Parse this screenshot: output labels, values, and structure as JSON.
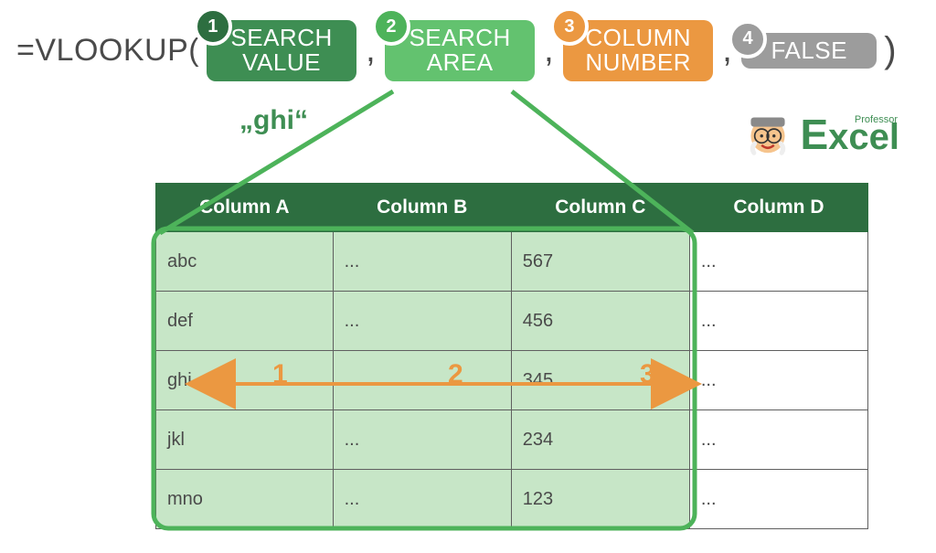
{
  "formula": {
    "prefix": "=VLOOKUP(",
    "args": [
      {
        "num": "1",
        "lines": [
          "SEARCH",
          "VALUE"
        ],
        "badge": "b-dark",
        "cls": "dark"
      },
      {
        "num": "2",
        "lines": [
          "SEARCH",
          "AREA"
        ],
        "badge": "b-light",
        "cls": "light"
      },
      {
        "num": "3",
        "lines": [
          "COLUMN",
          "NUMBER"
        ],
        "badge": "b-orange",
        "cls": "orange"
      },
      {
        "num": "4",
        "lines": [
          "FALSE"
        ],
        "badge": "b-grey",
        "cls": "grey small"
      }
    ],
    "close": ")"
  },
  "search_example": "„ghi“",
  "logo": {
    "word": "Excel",
    "tag": "Professor"
  },
  "table": {
    "headers": [
      "Column A",
      "Column B",
      "Column C",
      "Column D"
    ],
    "rows": [
      [
        "abc",
        "...",
        "567",
        "..."
      ],
      [
        "def",
        "...",
        "456",
        "..."
      ],
      [
        "ghi",
        "...",
        "345",
        "..."
      ],
      [
        "jkl",
        "...",
        "234",
        "..."
      ],
      [
        "mno",
        "...",
        "123",
        "..."
      ]
    ],
    "highlight_cols": [
      0,
      1,
      2
    ]
  },
  "arrow": {
    "nums": [
      "1",
      "2",
      "3"
    ]
  }
}
